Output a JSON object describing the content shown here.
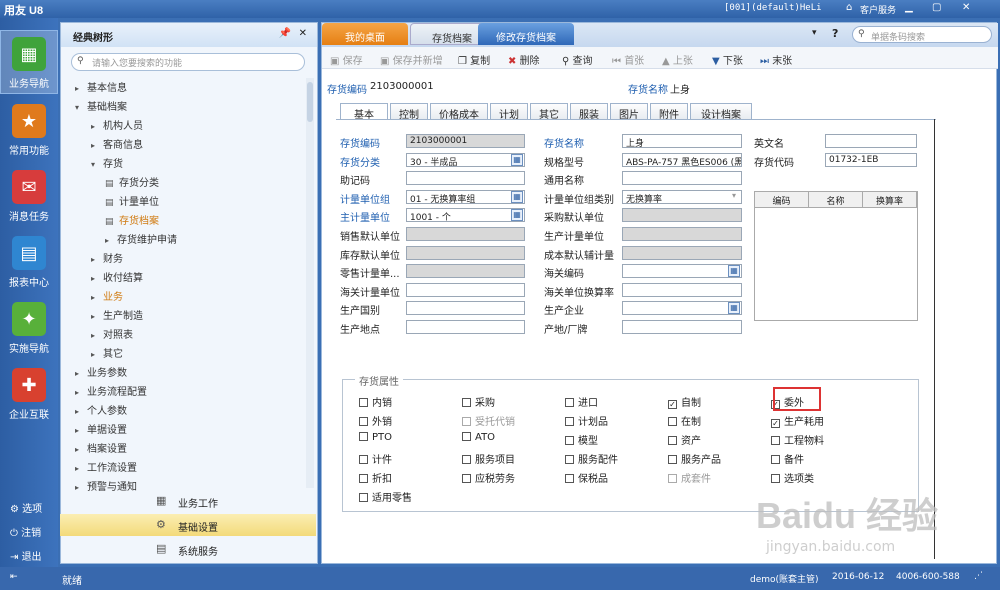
{
  "app": {
    "logo": "用友 U8",
    "user": "[001](default)HeLi",
    "service": "客户服务",
    "search_placeholder": "单据条码搜索"
  },
  "leftbar": {
    "items": [
      "业务导航",
      "常用功能",
      "消息任务",
      "报表中心",
      "实施导航",
      "企业互联"
    ],
    "options": "选项",
    "logout": "注销",
    "exit": "退出"
  },
  "nav": {
    "title": "经典树形",
    "search_placeholder": "请输入您要搜索的功能",
    "tree": [
      {
        "label": "基本信息",
        "lvl": 1,
        "arrow": "▸"
      },
      {
        "label": "基础档案",
        "lvl": 1,
        "arrow": "▾"
      },
      {
        "label": "机构人员",
        "lvl": 2,
        "arrow": "▸"
      },
      {
        "label": "客商信息",
        "lvl": 2,
        "arrow": "▸"
      },
      {
        "label": "存货",
        "lvl": 2,
        "arrow": "▾"
      },
      {
        "label": "存货分类",
        "lvl": 3,
        "doc": true
      },
      {
        "label": "计量单位",
        "lvl": 3,
        "doc": true
      },
      {
        "label": "存货档案",
        "lvl": 3,
        "doc": true,
        "sel": true
      },
      {
        "label": "存货维护申请",
        "lvl": 3,
        "arrow": "▸"
      },
      {
        "label": "财务",
        "lvl": 2,
        "arrow": "▸"
      },
      {
        "label": "收付结算",
        "lvl": 2,
        "arrow": "▸"
      },
      {
        "label": "业务",
        "lvl": 2,
        "arrow": "▸",
        "sel": true
      },
      {
        "label": "生产制造",
        "lvl": 2,
        "arrow": "▸"
      },
      {
        "label": "对照表",
        "lvl": 2,
        "arrow": "▸"
      },
      {
        "label": "其它",
        "lvl": 2,
        "arrow": "▸"
      },
      {
        "label": "业务参数",
        "lvl": 1,
        "arrow": "▸"
      },
      {
        "label": "业务流程配置",
        "lvl": 1,
        "arrow": "▸"
      },
      {
        "label": "个人参数",
        "lvl": 1,
        "arrow": "▸"
      },
      {
        "label": "单据设置",
        "lvl": 1,
        "arrow": "▸"
      },
      {
        "label": "档案设置",
        "lvl": 1,
        "arrow": "▸"
      },
      {
        "label": "工作流设置",
        "lvl": 1,
        "arrow": "▸"
      },
      {
        "label": "预警与通知",
        "lvl": 1,
        "arrow": "▸"
      }
    ],
    "bottom": [
      "业务工作",
      "基础设置",
      "系统服务"
    ]
  },
  "tabs": [
    "我的桌面",
    "存货档案",
    "修改存货档案"
  ],
  "toolbar": [
    "保存",
    "保存并新增",
    "复制",
    "删除",
    "查询",
    "首张",
    "上张",
    "下张",
    "末张"
  ],
  "header": {
    "code_label": "存货编码",
    "code": "2103000001",
    "name_label": "存货名称",
    "name": "上身"
  },
  "subtabs": [
    "基本",
    "控制",
    "价格成本",
    "计划",
    "其它",
    "服装",
    "图片",
    "附件",
    "设计档案"
  ],
  "form": {
    "col1": [
      {
        "l": "存货编码",
        "v": "2103000001",
        "blue": true,
        "gray": true
      },
      {
        "l": "存货分类",
        "v": "30 - 半成品",
        "blue": true,
        "pick": true
      },
      {
        "l": "助记码",
        "v": ""
      },
      {
        "l": "计量单位组",
        "v": "01 - 无换算率组",
        "blue": true,
        "pick": true
      },
      {
        "l": "主计量单位",
        "v": "1001 - 个",
        "blue": true,
        "pick": true
      },
      {
        "l": "销售默认单位",
        "v": "",
        "gray": true
      },
      {
        "l": "库存默认单位",
        "v": "",
        "gray": true
      },
      {
        "l": "零售计量单...",
        "v": "",
        "gray": true
      },
      {
        "l": "海关计量单位",
        "v": ""
      },
      {
        "l": "生产国别",
        "v": ""
      },
      {
        "l": "生产地点",
        "v": ""
      }
    ],
    "col2": [
      {
        "l": "存货名称",
        "v": "上身",
        "blue": true
      },
      {
        "l": "规格型号",
        "v": "ABS-PA-757 黑色ES006 (黑"
      },
      {
        "l": "通用名称",
        "v": ""
      },
      {
        "l": "计量单位组类别",
        "v": "无换算率",
        "drop": true
      },
      {
        "l": "采购默认单位",
        "v": "",
        "gray": true
      },
      {
        "l": "生产计量单位",
        "v": "",
        "gray": true
      },
      {
        "l": "成本默认辅计量",
        "v": "",
        "gray": true
      },
      {
        "l": "海关编码",
        "v": "",
        "pick": true
      },
      {
        "l": "海关单位换算率",
        "v": ""
      },
      {
        "l": "生产企业",
        "v": "",
        "pick": true
      },
      {
        "l": "产地/厂牌",
        "v": ""
      }
    ],
    "col3": [
      {
        "l": "英文名",
        "v": ""
      },
      {
        "l": "存货代码",
        "v": "01732-1EB"
      }
    ],
    "grid_headers": [
      "编码",
      "名称",
      "换算率"
    ]
  },
  "attrs": {
    "title": "存货属性",
    "items": [
      [
        "内销",
        false,
        false
      ],
      [
        "采购",
        false,
        false
      ],
      [
        "进口",
        false,
        false
      ],
      [
        "自制",
        true,
        false
      ],
      [
        "委外",
        true,
        false
      ],
      [
        "外销",
        false,
        false
      ],
      [
        "受托代销",
        false,
        true
      ],
      [
        "计划品",
        false,
        false
      ],
      [
        "在制",
        false,
        false
      ],
      [
        "生产耗用",
        true,
        false
      ],
      [
        "PTO",
        false,
        false
      ],
      [
        "ATO",
        false,
        false
      ],
      [
        "模型",
        false,
        false
      ],
      [
        "资产",
        false,
        false
      ],
      [
        "工程物料",
        false,
        false
      ],
      [
        "计件",
        false,
        false
      ],
      [
        "服务项目",
        false,
        false
      ],
      [
        "服务配件",
        false,
        false
      ],
      [
        "服务产品",
        false,
        false
      ],
      [
        "备件",
        false,
        false
      ],
      [
        "折扣",
        false,
        false
      ],
      [
        "应税劳务",
        false,
        false
      ],
      [
        "保税品",
        false,
        false
      ],
      [
        "成套件",
        false,
        true
      ],
      [
        "选项类",
        false,
        false
      ],
      [
        "适用零售",
        false,
        false
      ]
    ]
  },
  "status": {
    "left": "就绪",
    "user": "demo(账套主管)",
    "date": "2016-06-12",
    "phone": "4006-600-588"
  },
  "watermark": {
    "line1": "Baidu 经验",
    "line2": "jingyan.baidu.com"
  }
}
